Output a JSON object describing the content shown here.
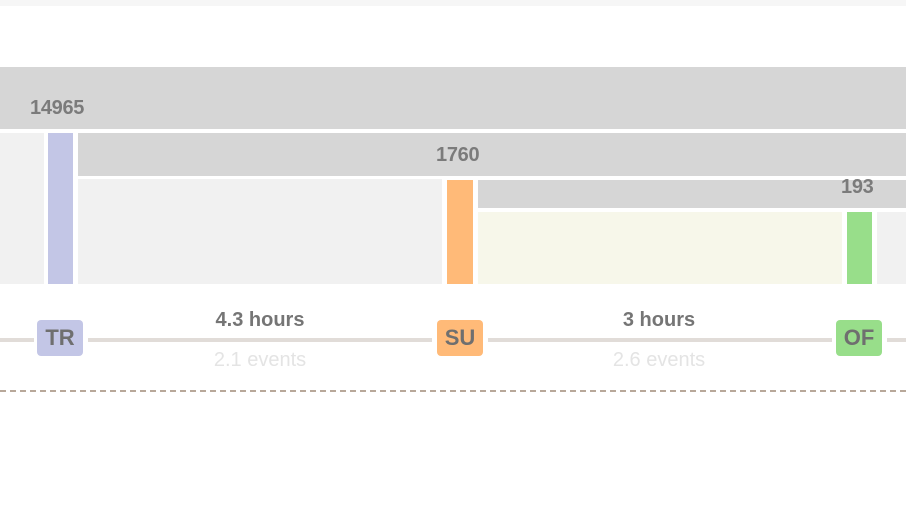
{
  "funnel": {
    "steps": [
      {
        "code": "TR",
        "count": "14965",
        "color": "#c3c6e6"
      },
      {
        "code": "SU",
        "count": "1760",
        "color": "#ffba78"
      },
      {
        "code": "OF",
        "count": "193",
        "color": "#98de8a"
      }
    ],
    "transitions": [
      {
        "duration": "4.3 hours",
        "events": "2.1 events"
      },
      {
        "duration": "3 hours",
        "events": "2.6 events"
      }
    ]
  }
}
